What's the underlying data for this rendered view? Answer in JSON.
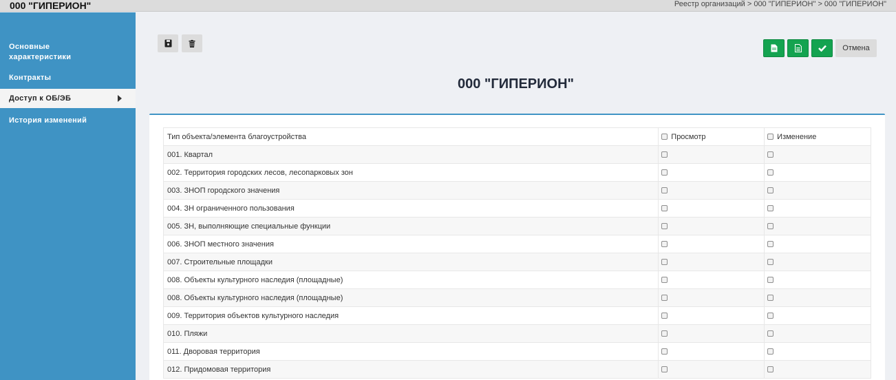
{
  "header": {
    "org_title": "000 \"ГИПЕРИОН\"",
    "breadcrumb": "Реестр организаций > 000 \"ГИПЕРИОН\" > 000 \"ГИПЕРИОН\""
  },
  "sidebar": {
    "items": [
      {
        "label": "Основные характеристики"
      },
      {
        "label": "Контракты"
      },
      {
        "label": "Доступ к ОБ/ЭБ"
      },
      {
        "label": "История изменений"
      }
    ],
    "active_index": 2
  },
  "toolbar": {
    "left_icons": [
      "save-icon",
      "trash-icon"
    ],
    "right_icons": [
      "file-icon",
      "document-icon",
      "check-icon"
    ],
    "cancel_label": "Отмена"
  },
  "page": {
    "title": "000 \"ГИПЕРИОН\""
  },
  "table": {
    "columns": [
      "Тип объекта/элемента благоустройства",
      "Просмотр",
      "Изменение"
    ],
    "rows": [
      "001. Квартал",
      "002. Территория городских лесов, лесопарковых зон",
      "003. ЗНОП городского значения",
      "004. ЗН ограниченного пользования",
      "005. ЗН, выполняющие специальные функции",
      "006. ЗНОП местного значения",
      "007. Строительные площадки",
      "008. Объекты культурного наследия (площадные)",
      "008. Объекты культурного наследия (площадные)",
      "009. Территория объектов культурного наследия",
      "010. Пляжи",
      "011. Дворовая территория",
      "012. Придомовая территория"
    ]
  },
  "colors": {
    "sidebar_bg": "#3f93c4",
    "accent_green": "#14a350",
    "panel_border": "#3f93c4"
  }
}
